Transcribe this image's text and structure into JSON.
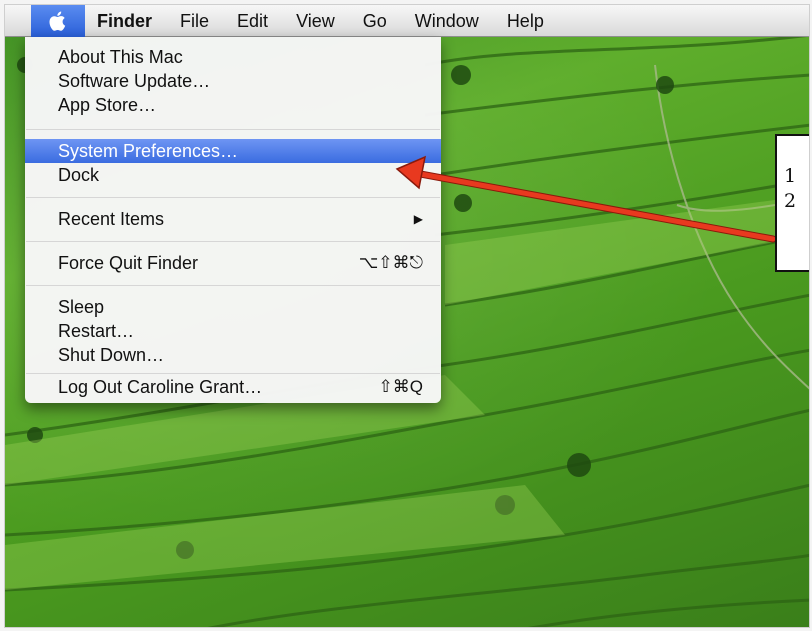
{
  "menubar": {
    "apple_icon": "apple-icon",
    "items": [
      {
        "label": "Finder",
        "bold": true
      },
      {
        "label": "File"
      },
      {
        "label": "Edit"
      },
      {
        "label": "View"
      },
      {
        "label": "Go"
      },
      {
        "label": "Window"
      },
      {
        "label": "Help"
      }
    ]
  },
  "apple_menu": {
    "items": [
      {
        "label": "About This Mac"
      },
      {
        "label": "Software Update…"
      },
      {
        "label": "App Store…"
      },
      {
        "label": "System Preferences…",
        "highlighted": true
      },
      {
        "label": "Dock",
        "submenu": true
      },
      {
        "label": "Recent Items",
        "submenu": true
      },
      {
        "label": "Force Quit Finder",
        "shortcut": "⌥⇧⌘⎋"
      },
      {
        "label": "Sleep"
      },
      {
        "label": "Restart…"
      },
      {
        "label": "Shut Down…"
      },
      {
        "label": "Log Out Caroline Grant…",
        "shortcut": "⇧⌘Q"
      }
    ],
    "submenu_glyph": "▶"
  },
  "annotation": {
    "lines": [
      "1",
      "2"
    ],
    "arrow_color": "#e8391f"
  },
  "colors": {
    "highlight": "#3a6ce0",
    "menubar_bg": "#e6e6e6"
  }
}
